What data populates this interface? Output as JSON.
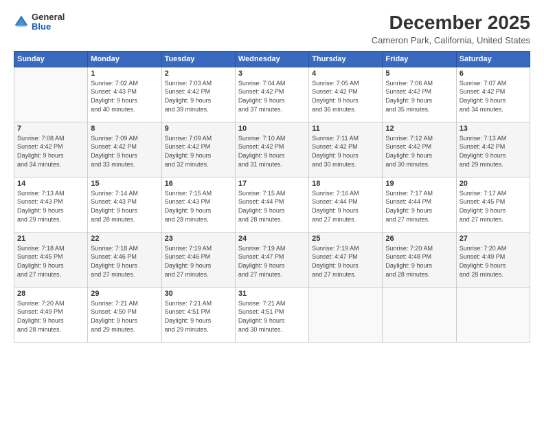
{
  "header": {
    "logo": {
      "general": "General",
      "blue": "Blue"
    },
    "title": "December 2025",
    "subtitle": "Cameron Park, California, United States"
  },
  "calendar": {
    "days_of_week": [
      "Sunday",
      "Monday",
      "Tuesday",
      "Wednesday",
      "Thursday",
      "Friday",
      "Saturday"
    ],
    "weeks": [
      [
        {
          "day": "",
          "info": ""
        },
        {
          "day": "1",
          "info": "Sunrise: 7:02 AM\nSunset: 4:43 PM\nDaylight: 9 hours\nand 40 minutes."
        },
        {
          "day": "2",
          "info": "Sunrise: 7:03 AM\nSunset: 4:42 PM\nDaylight: 9 hours\nand 39 minutes."
        },
        {
          "day": "3",
          "info": "Sunrise: 7:04 AM\nSunset: 4:42 PM\nDaylight: 9 hours\nand 37 minutes."
        },
        {
          "day": "4",
          "info": "Sunrise: 7:05 AM\nSunset: 4:42 PM\nDaylight: 9 hours\nand 36 minutes."
        },
        {
          "day": "5",
          "info": "Sunrise: 7:06 AM\nSunset: 4:42 PM\nDaylight: 9 hours\nand 35 minutes."
        },
        {
          "day": "6",
          "info": "Sunrise: 7:07 AM\nSunset: 4:42 PM\nDaylight: 9 hours\nand 34 minutes."
        }
      ],
      [
        {
          "day": "7",
          "info": "Sunrise: 7:08 AM\nSunset: 4:42 PM\nDaylight: 9 hours\nand 34 minutes."
        },
        {
          "day": "8",
          "info": "Sunrise: 7:09 AM\nSunset: 4:42 PM\nDaylight: 9 hours\nand 33 minutes."
        },
        {
          "day": "9",
          "info": "Sunrise: 7:09 AM\nSunset: 4:42 PM\nDaylight: 9 hours\nand 32 minutes."
        },
        {
          "day": "10",
          "info": "Sunrise: 7:10 AM\nSunset: 4:42 PM\nDaylight: 9 hours\nand 31 minutes."
        },
        {
          "day": "11",
          "info": "Sunrise: 7:11 AM\nSunset: 4:42 PM\nDaylight: 9 hours\nand 30 minutes."
        },
        {
          "day": "12",
          "info": "Sunrise: 7:12 AM\nSunset: 4:42 PM\nDaylight: 9 hours\nand 30 minutes."
        },
        {
          "day": "13",
          "info": "Sunrise: 7:13 AM\nSunset: 4:42 PM\nDaylight: 9 hours\nand 29 minutes."
        }
      ],
      [
        {
          "day": "14",
          "info": "Sunrise: 7:13 AM\nSunset: 4:43 PM\nDaylight: 9 hours\nand 29 minutes."
        },
        {
          "day": "15",
          "info": "Sunrise: 7:14 AM\nSunset: 4:43 PM\nDaylight: 9 hours\nand 28 minutes."
        },
        {
          "day": "16",
          "info": "Sunrise: 7:15 AM\nSunset: 4:43 PM\nDaylight: 9 hours\nand 28 minutes."
        },
        {
          "day": "17",
          "info": "Sunrise: 7:15 AM\nSunset: 4:44 PM\nDaylight: 9 hours\nand 28 minutes."
        },
        {
          "day": "18",
          "info": "Sunrise: 7:16 AM\nSunset: 4:44 PM\nDaylight: 9 hours\nand 27 minutes."
        },
        {
          "day": "19",
          "info": "Sunrise: 7:17 AM\nSunset: 4:44 PM\nDaylight: 9 hours\nand 27 minutes."
        },
        {
          "day": "20",
          "info": "Sunrise: 7:17 AM\nSunset: 4:45 PM\nDaylight: 9 hours\nand 27 minutes."
        }
      ],
      [
        {
          "day": "21",
          "info": "Sunrise: 7:18 AM\nSunset: 4:45 PM\nDaylight: 9 hours\nand 27 minutes."
        },
        {
          "day": "22",
          "info": "Sunrise: 7:18 AM\nSunset: 4:46 PM\nDaylight: 9 hours\nand 27 minutes."
        },
        {
          "day": "23",
          "info": "Sunrise: 7:19 AM\nSunset: 4:46 PM\nDaylight: 9 hours\nand 27 minutes."
        },
        {
          "day": "24",
          "info": "Sunrise: 7:19 AM\nSunset: 4:47 PM\nDaylight: 9 hours\nand 27 minutes."
        },
        {
          "day": "25",
          "info": "Sunrise: 7:19 AM\nSunset: 4:47 PM\nDaylight: 9 hours\nand 27 minutes."
        },
        {
          "day": "26",
          "info": "Sunrise: 7:20 AM\nSunset: 4:48 PM\nDaylight: 9 hours\nand 28 minutes."
        },
        {
          "day": "27",
          "info": "Sunrise: 7:20 AM\nSunset: 4:49 PM\nDaylight: 9 hours\nand 28 minutes."
        }
      ],
      [
        {
          "day": "28",
          "info": "Sunrise: 7:20 AM\nSunset: 4:49 PM\nDaylight: 9 hours\nand 28 minutes."
        },
        {
          "day": "29",
          "info": "Sunrise: 7:21 AM\nSunset: 4:50 PM\nDaylight: 9 hours\nand 29 minutes."
        },
        {
          "day": "30",
          "info": "Sunrise: 7:21 AM\nSunset: 4:51 PM\nDaylight: 9 hours\nand 29 minutes."
        },
        {
          "day": "31",
          "info": "Sunrise: 7:21 AM\nSunset: 4:51 PM\nDaylight: 9 hours\nand 30 minutes."
        },
        {
          "day": "",
          "info": ""
        },
        {
          "day": "",
          "info": ""
        },
        {
          "day": "",
          "info": ""
        }
      ]
    ]
  }
}
